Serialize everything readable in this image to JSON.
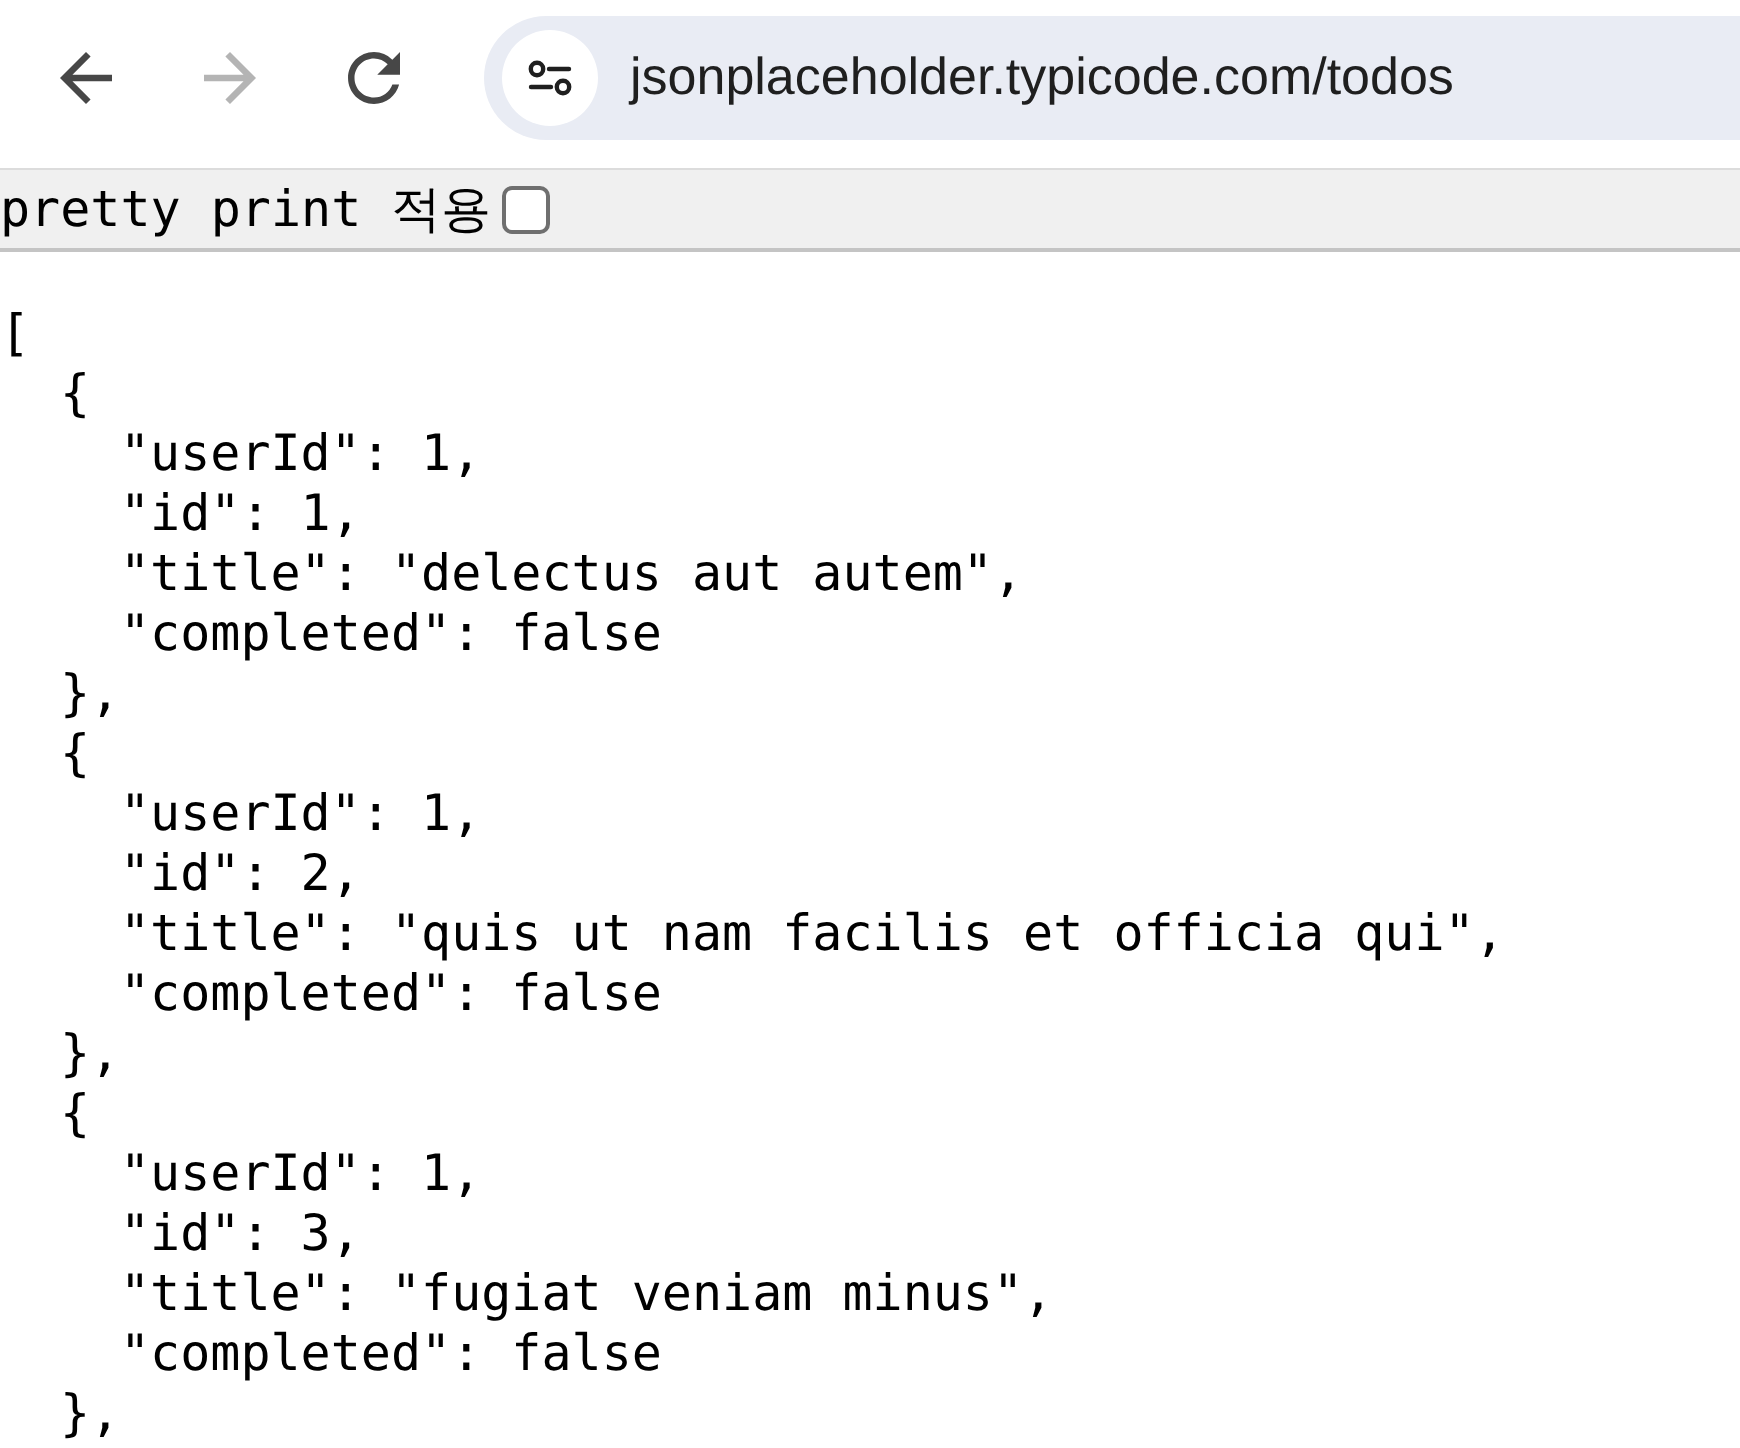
{
  "toolbar": {
    "buttons": [
      {
        "kind": "back",
        "disabled": false
      },
      {
        "kind": "forward",
        "disabled": true
      },
      {
        "kind": "reload",
        "disabled": false
      }
    ],
    "address_bar": {
      "url": "jsonplaceholder.typicode.com/todos"
    }
  },
  "pretty_print": {
    "label": "pretty print 적용",
    "checked": false
  },
  "json_view": {
    "open": "[",
    "children": [
      {
        "open": "{",
        "lines": [
          "\"userId\": 1,",
          "\"id\": 1,",
          "\"title\": \"delectus aut autem\",",
          "\"completed\": false"
        ],
        "close": "},"
      },
      {
        "open": "{",
        "lines": [
          "\"userId\": 1,",
          "\"id\": 2,",
          "\"title\": \"quis ut nam facilis et officia qui\",",
          "\"completed\": false"
        ],
        "close": "},"
      },
      {
        "open": "{",
        "lines": [
          "\"userId\": 1,",
          "\"id\": 3,",
          "\"title\": \"fugiat veniam minus\",",
          "\"completed\": false"
        ],
        "close": "},"
      }
    ]
  }
}
